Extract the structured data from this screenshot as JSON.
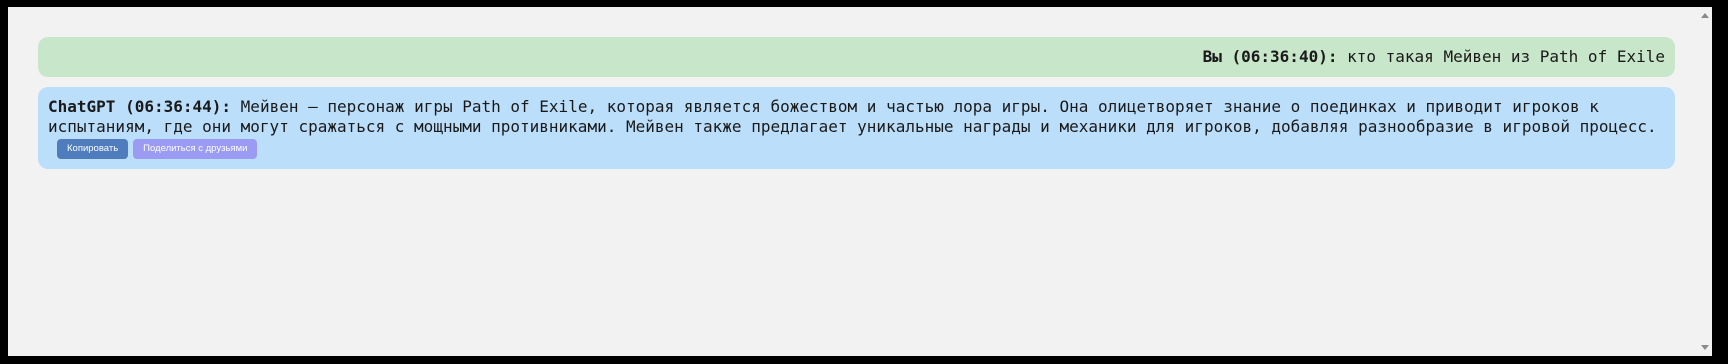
{
  "messages": {
    "user": {
      "sender": "Вы (06:36:40):",
      "text": "кто такая Мейвен из Path of Exile"
    },
    "bot": {
      "sender": "ChatGPT (06:36:44):",
      "text": "Мейвен – персонаж игры Path of Exile, которая является божеством и частью лора игры. Она олицетворяет знание о поединках и приводит игроков к испытаниям, где они могут сражаться с мощными противниками. Мейвен также предлагает уникальные награды и механики для игроков, добавляя разнообразие в игровой процесс."
    }
  },
  "actions": {
    "copy_label": "Копировать",
    "share_label": "Поделиться с друзьями"
  },
  "colors": {
    "user_bubble": "#c8e6c9",
    "bot_bubble": "#bbdefb",
    "copy_button": "#4f7cbd",
    "share_button": "#9b9bf4",
    "background": "#f2f2f2"
  },
  "icons": {
    "scroll_up": "triangle-up",
    "scroll_down": "triangle-down"
  }
}
